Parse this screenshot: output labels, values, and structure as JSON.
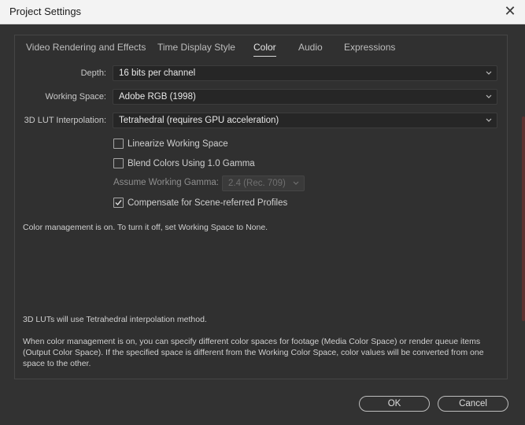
{
  "window": {
    "title": "Project Settings"
  },
  "tabs": [
    {
      "label": "Video Rendering and Effects"
    },
    {
      "label": "Time Display Style"
    },
    {
      "label": "Color"
    },
    {
      "label": "Audio"
    },
    {
      "label": "Expressions"
    }
  ],
  "color": {
    "depth": {
      "label": "Depth:",
      "value": "16 bits per channel"
    },
    "working_space": {
      "label": "Working Space:",
      "value": "Adobe RGB (1998)"
    },
    "lut": {
      "label": "3D LUT Interpolation:",
      "value": "Tetrahedral (requires GPU acceleration)"
    },
    "linearize": {
      "label": "Linearize Working Space",
      "checked": false
    },
    "blend": {
      "label": "Blend Colors Using 1.0 Gamma",
      "checked": false
    },
    "gamma": {
      "label": "Assume Working Gamma:",
      "value": "2.4 (Rec. 709)"
    },
    "compensate": {
      "label": "Compensate for Scene-referred Profiles",
      "checked": true
    },
    "status_text": "Color management is on. To turn it off, set Working Space to None.",
    "lut_note": "3D LUTs will use Tetrahedral interpolation method.",
    "description": "When color management is on, you can specify different color spaces for footage (Media Color Space) or render queue items (Output Color Space). If the specified space is different from the Working Color Space, color values will be converted from one space to the other."
  },
  "buttons": {
    "ok": "OK",
    "cancel": "Cancel"
  },
  "colors": {
    "background": "#323232",
    "titlebar": "#f3f3f3",
    "field": "#262626"
  }
}
